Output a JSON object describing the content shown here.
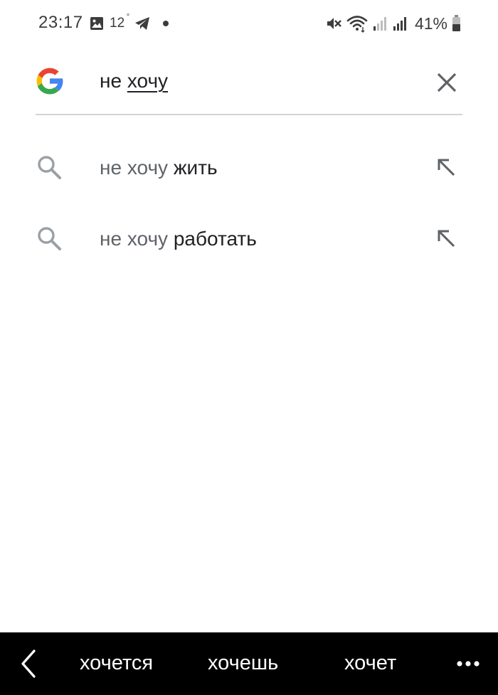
{
  "status_bar": {
    "time": "23:17",
    "temperature": "12",
    "temperature_unit": "°",
    "battery": "41%",
    "icons": [
      "gallery-icon",
      "telegram-icon",
      "notification-dot",
      "mute-icon",
      "wifi-icon",
      "signal-icon",
      "signal-icon",
      "battery-icon"
    ]
  },
  "search": {
    "query_plain": "не ",
    "query_underlined": "хочу"
  },
  "suggestions": [
    {
      "prefix": "не хочу ",
      "completion": "жить"
    },
    {
      "prefix": "не хочу ",
      "completion": "работать"
    }
  ],
  "keyboard_suggestions": {
    "words": [
      "хочется",
      "хочешь",
      "хочет"
    ]
  },
  "colors": {
    "google_blue": "#4285F4",
    "google_red": "#EA4335",
    "google_yellow": "#FBBC05",
    "google_green": "#34A853",
    "icon_gray": "#9aa0a6",
    "keyboard_bg": "#000000"
  }
}
